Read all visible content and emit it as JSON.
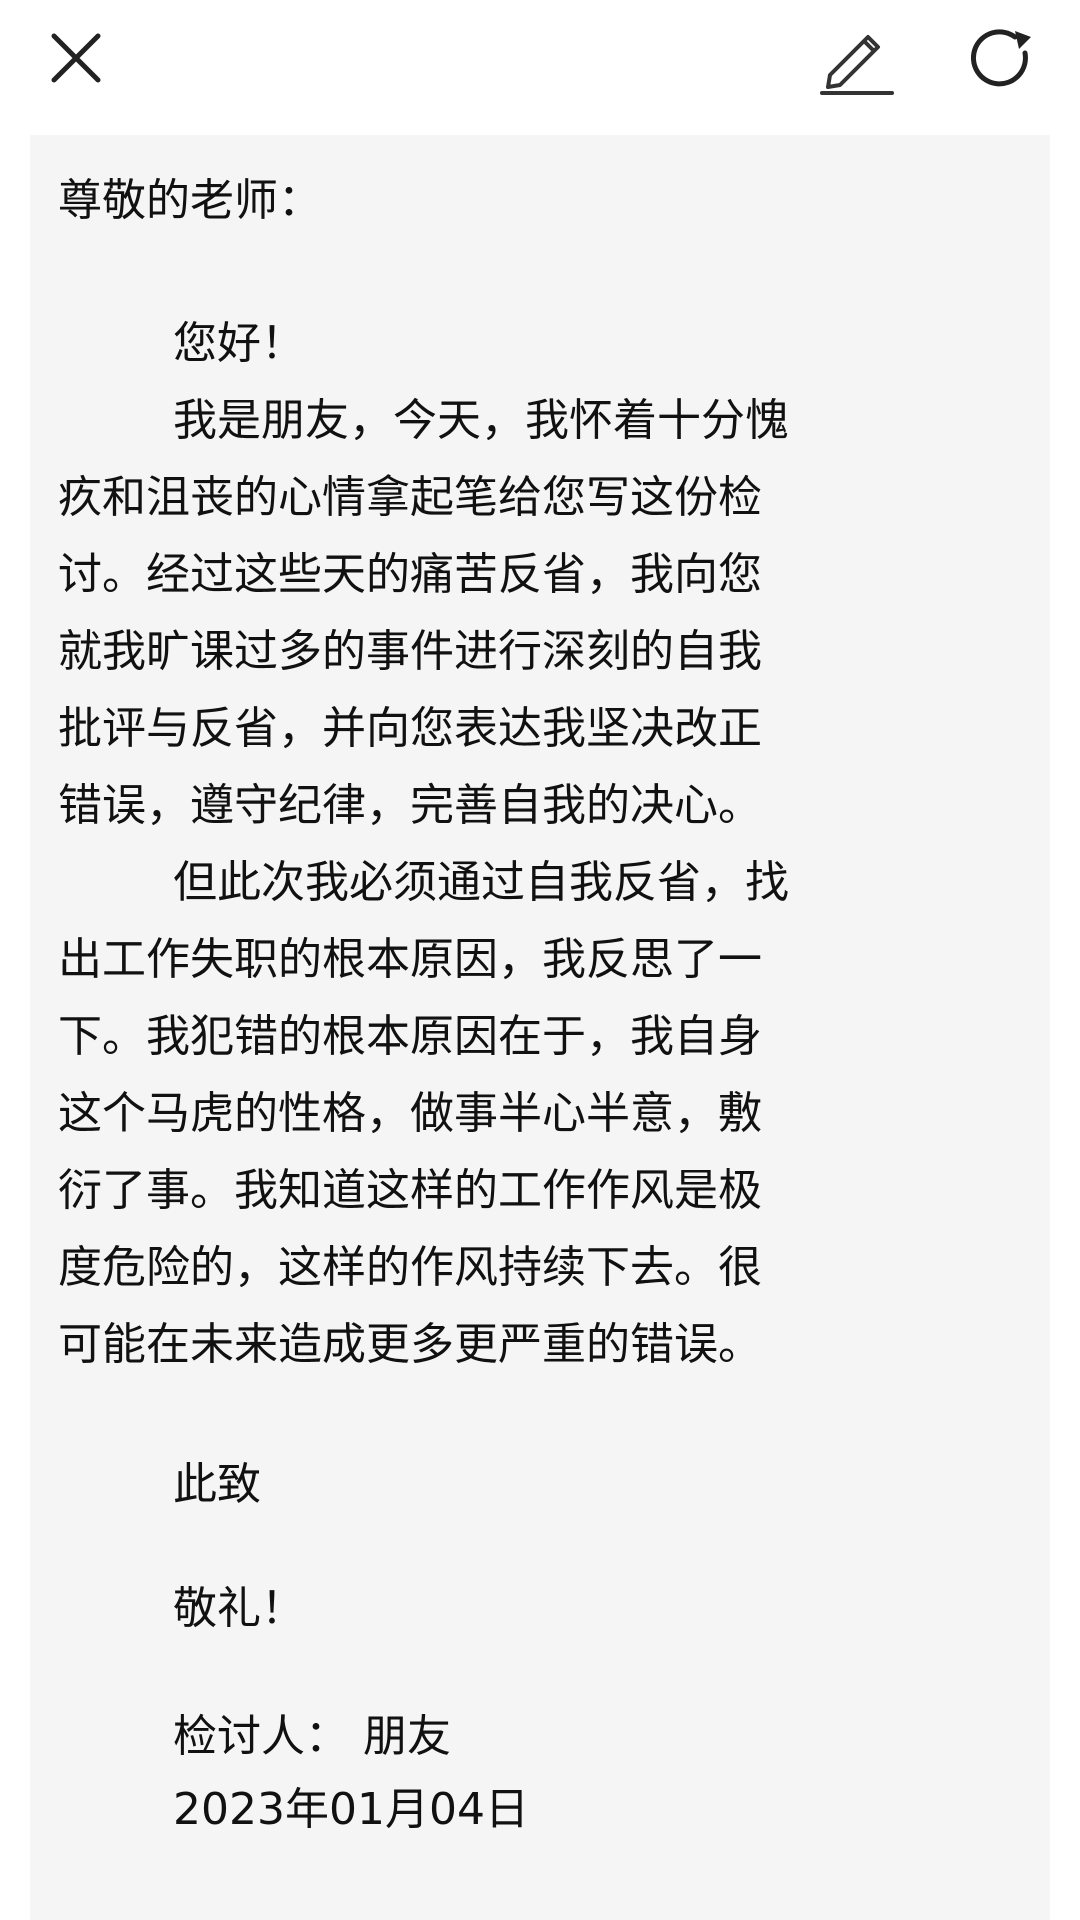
{
  "toolbar": {
    "close_icon": "close-icon",
    "edit_icon": "pencil-icon",
    "refresh_icon": "refresh-icon"
  },
  "letter": {
    "salutation": "尊敬的老师：",
    "greeting": "您好！",
    "paragraph1_lines": [
      "我是朋友，今天，我怀着十分愧",
      "疚和沮丧的心情拿起笔给您写这份检",
      "讨。经过这些天的痛苦反省，我向您",
      "就我旷课过多的事件进行深刻的自我",
      "批评与反省，并向您表达我坚决改正",
      "错误，遵守纪律，完善自我的决心。"
    ],
    "paragraph2_lines": [
      "但此次我必须通过自我反省，找",
      "出工作失职的根本原因，我反思了一",
      "下。我犯错的根本原因在于，我自身",
      "这个马虎的性格，做事半心半意，敷",
      "衍了事。我知道这样的工作作风是极",
      "度危险的，这样的作风持续下去。很",
      "可能在未来造成更多更严重的错误。"
    ],
    "closing": "此致",
    "regards": "敬礼！",
    "signer": "检讨人：  朋友",
    "date": "2023年01月04日"
  }
}
